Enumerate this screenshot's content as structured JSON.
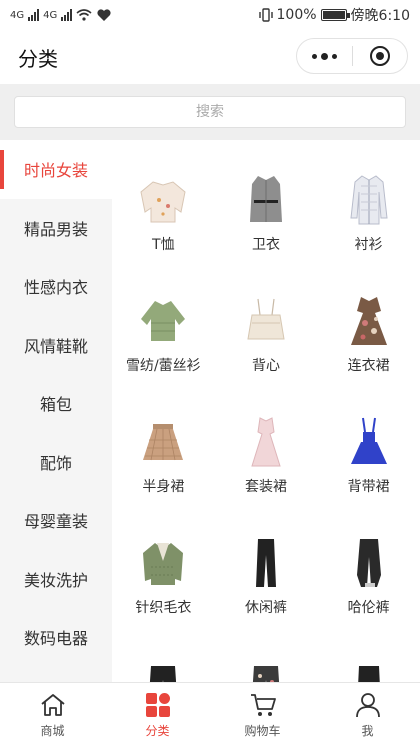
{
  "status_bar": {
    "left_signal_1": "4G",
    "left_signal_2": "4G",
    "battery": "100%",
    "time": "傍晚6:10"
  },
  "header": {
    "title": "分类"
  },
  "search": {
    "placeholder": "搜索"
  },
  "sidebar": {
    "items": [
      {
        "label": "时尚女装",
        "active": true
      },
      {
        "label": "精品男装"
      },
      {
        "label": "性感内衣"
      },
      {
        "label": "风情鞋靴"
      },
      {
        "label": "箱包"
      },
      {
        "label": "配饰"
      },
      {
        "label": "母婴童装"
      },
      {
        "label": "美妆洗护"
      },
      {
        "label": "数码电器"
      }
    ]
  },
  "grid": {
    "items": [
      {
        "label": "T恤",
        "icon": "sweater-icon",
        "color": "#f3e7dc"
      },
      {
        "label": "卫衣",
        "icon": "coat-icon",
        "color": "#8e8e8e"
      },
      {
        "label": "衬衫",
        "icon": "shirt-icon",
        "color": "#c7cbd6"
      },
      {
        "label": "雪纺/蕾丝衫",
        "icon": "blouse-icon",
        "color": "#93a97a"
      },
      {
        "label": "背心",
        "icon": "camisole-icon",
        "color": "#efe6d8"
      },
      {
        "label": "连衣裙",
        "icon": "dress-icon",
        "color": "#7a5a45"
      },
      {
        "label": "半身裙",
        "icon": "skirt-icon",
        "color": "#caa07f"
      },
      {
        "label": "套装裙",
        "icon": "suit-dress-icon",
        "color": "#f1d6d8"
      },
      {
        "label": "背带裙",
        "icon": "overall-dress-icon",
        "color": "#3042c9"
      },
      {
        "label": "针织毛衣",
        "icon": "knit-sweater-icon",
        "color": "#7f9168"
      },
      {
        "label": "休闲裤",
        "icon": "pants-icon",
        "color": "#222222"
      },
      {
        "label": "哈伦裤",
        "icon": "harem-pants-icon",
        "color": "#2a2a2a"
      },
      {
        "label": "",
        "icon": "shorts-icon",
        "color": "#222222"
      },
      {
        "label": "",
        "icon": "patterned-shorts-icon",
        "color": "#3b3b3b"
      },
      {
        "label": "",
        "icon": "trousers-icon",
        "color": "#222222"
      }
    ]
  },
  "tabbar": {
    "tabs": [
      {
        "label": "商城",
        "icon": "home-icon"
      },
      {
        "label": "分类",
        "icon": "category-icon",
        "active": true
      },
      {
        "label": "购物车",
        "icon": "cart-icon"
      },
      {
        "label": "我",
        "icon": "user-icon"
      }
    ]
  },
  "colors": {
    "accent": "#e8453c",
    "sidebar_bg": "#f5f5f5",
    "search_bg": "#efefef"
  }
}
